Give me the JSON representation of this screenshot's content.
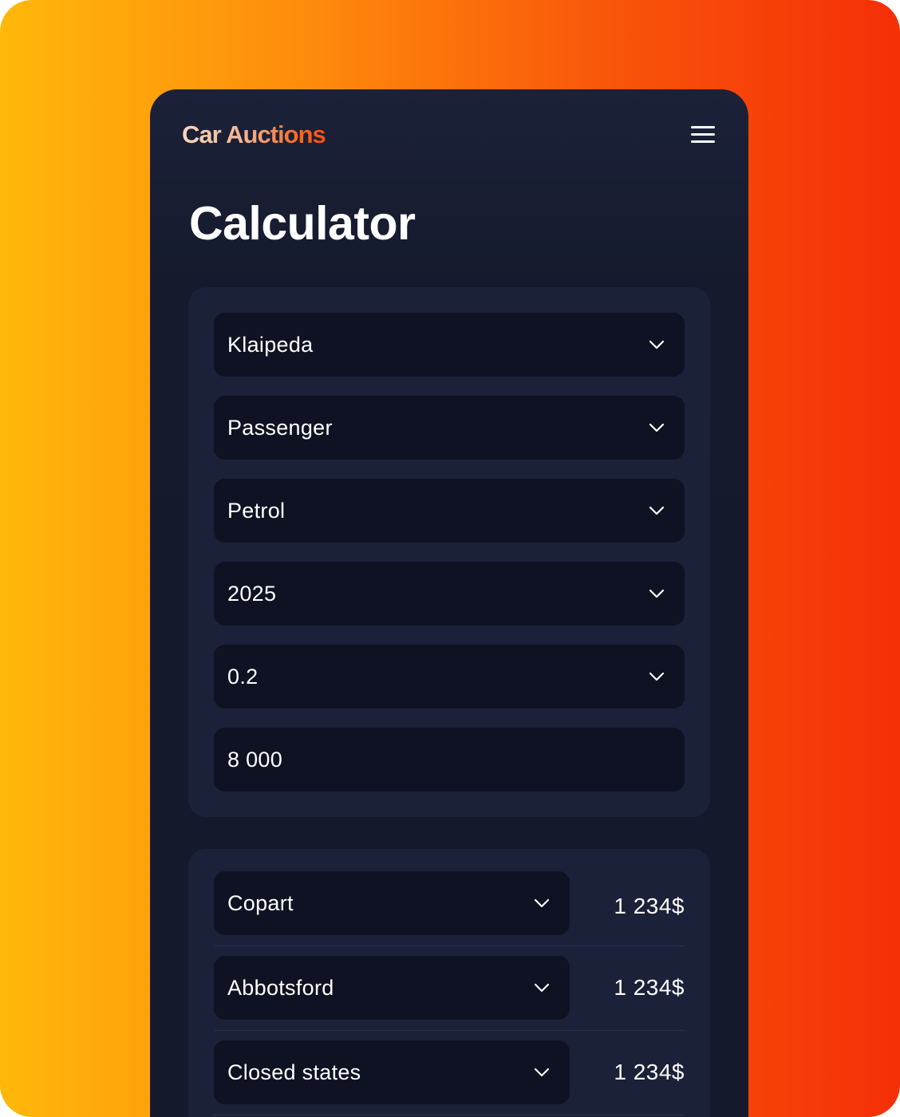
{
  "header": {
    "logo_text": "Car Auctions",
    "menu_icon": "hamburger-menu-icon"
  },
  "page": {
    "title": "Calculator"
  },
  "form": {
    "port": "Klaipeda",
    "vehicle_type": "Passenger",
    "fuel": "Petrol",
    "year": "2025",
    "engine_volume": "0.2",
    "price": "8 000",
    "chevron_icon": "chevron-down-icon"
  },
  "costs": [
    {
      "select": "Copart",
      "amount": "1 234$"
    },
    {
      "select": "Abbotsford",
      "amount": "1 234$"
    },
    {
      "select": "Closed states",
      "amount": "1 234$"
    }
  ],
  "colors": {
    "background_start": "#FFB80A",
    "background_end": "#F52F07",
    "panel": "#141A2C",
    "card": "#1B2139",
    "field": "#0E1222",
    "text": "#FFFFFF"
  }
}
